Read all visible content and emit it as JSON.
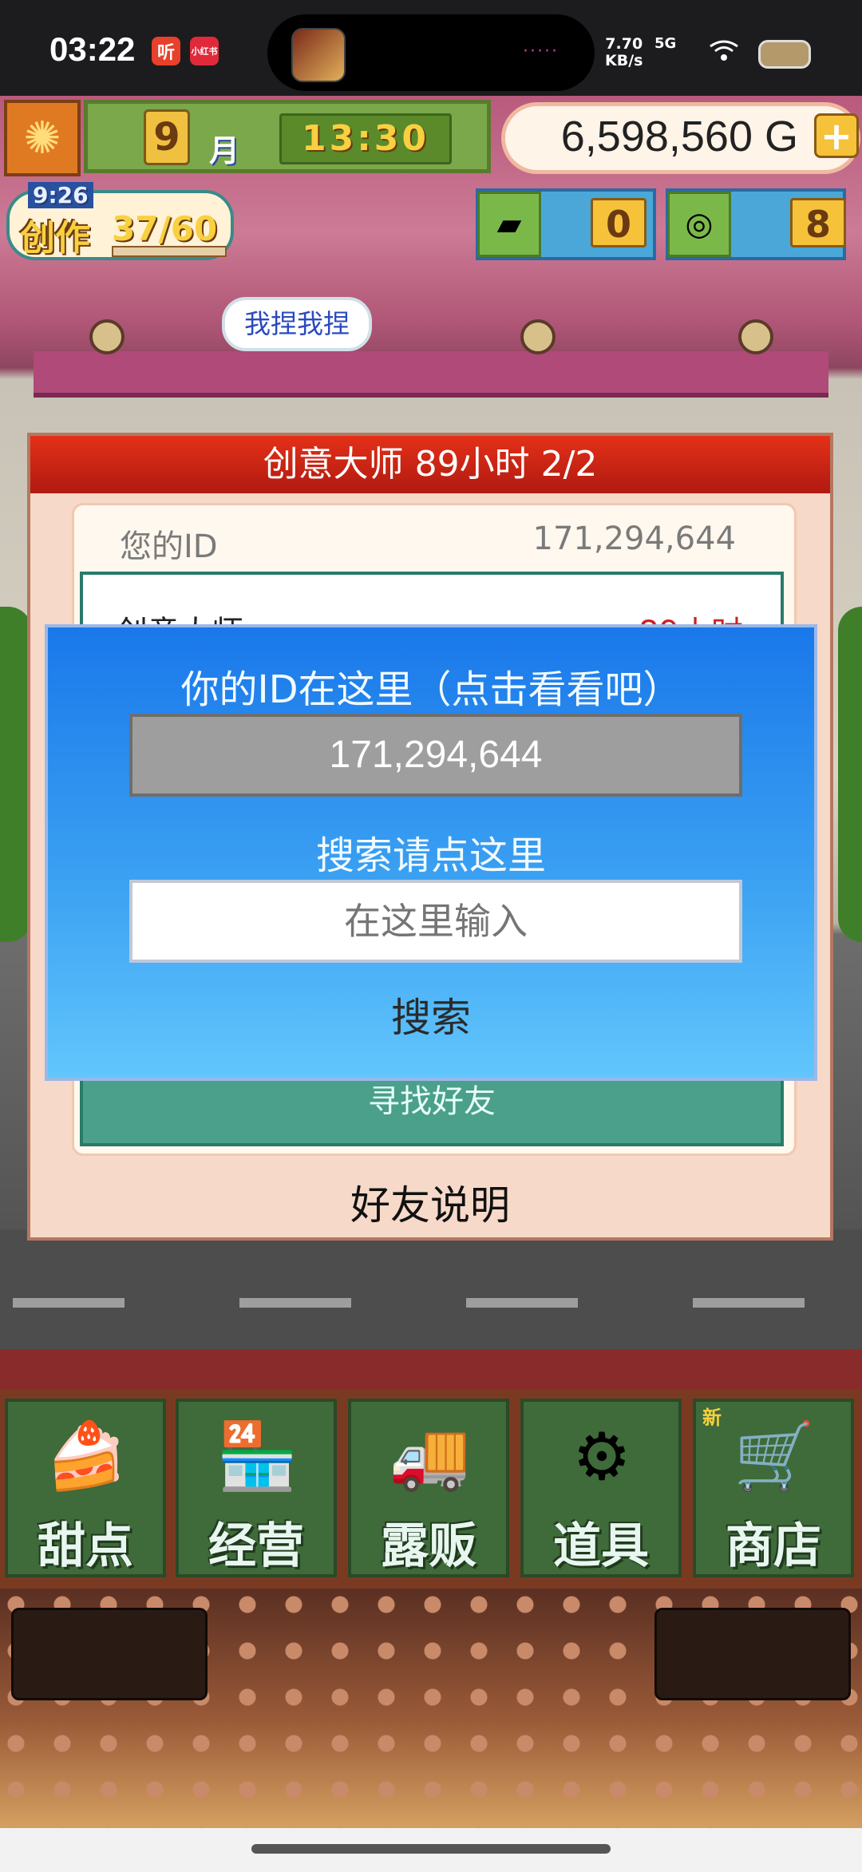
{
  "status_bar": {
    "time": "03:22",
    "app_badge_1": "听",
    "app_badge_2": "小红书",
    "island_dots": "·····",
    "net_speed_value": "7.70",
    "net_speed_unit": "KB/s",
    "network": "5G"
  },
  "hud": {
    "month_number": "9",
    "month_unit": "月",
    "game_time": "13:30",
    "gold": "6,598,560 G",
    "gold_add": "+",
    "create_timer": "9:26",
    "create_label": "创作",
    "create_count": "37/60",
    "gold_bar_count": "0",
    "medal_count": "8"
  },
  "bubble_text": "我捏我捏",
  "panel": {
    "title": "创意大师  89小时 2/2",
    "id_label": "您的ID",
    "id_value": "171,294,644",
    "list_peek_text": "创意大师",
    "list_peek_red": "89小时",
    "find_friend": "寻找好友",
    "explain": "好友说明"
  },
  "dialog": {
    "title": "你的ID在这里（点击看看吧）",
    "id_display": "171,294,644",
    "search_prompt": "搜索请点这里",
    "input_placeholder": "在这里输入",
    "search_button": "搜索"
  },
  "menu": {
    "items": [
      {
        "label": "甜点",
        "icon": "cake-icon"
      },
      {
        "label": "经营",
        "icon": "shop-icon"
      },
      {
        "label": "露贩",
        "icon": "food-truck-icon"
      },
      {
        "label": "道具",
        "icon": "gear-sack-icon"
      },
      {
        "label": "商店",
        "icon": "cart-icon"
      }
    ],
    "new_badge": "新"
  }
}
